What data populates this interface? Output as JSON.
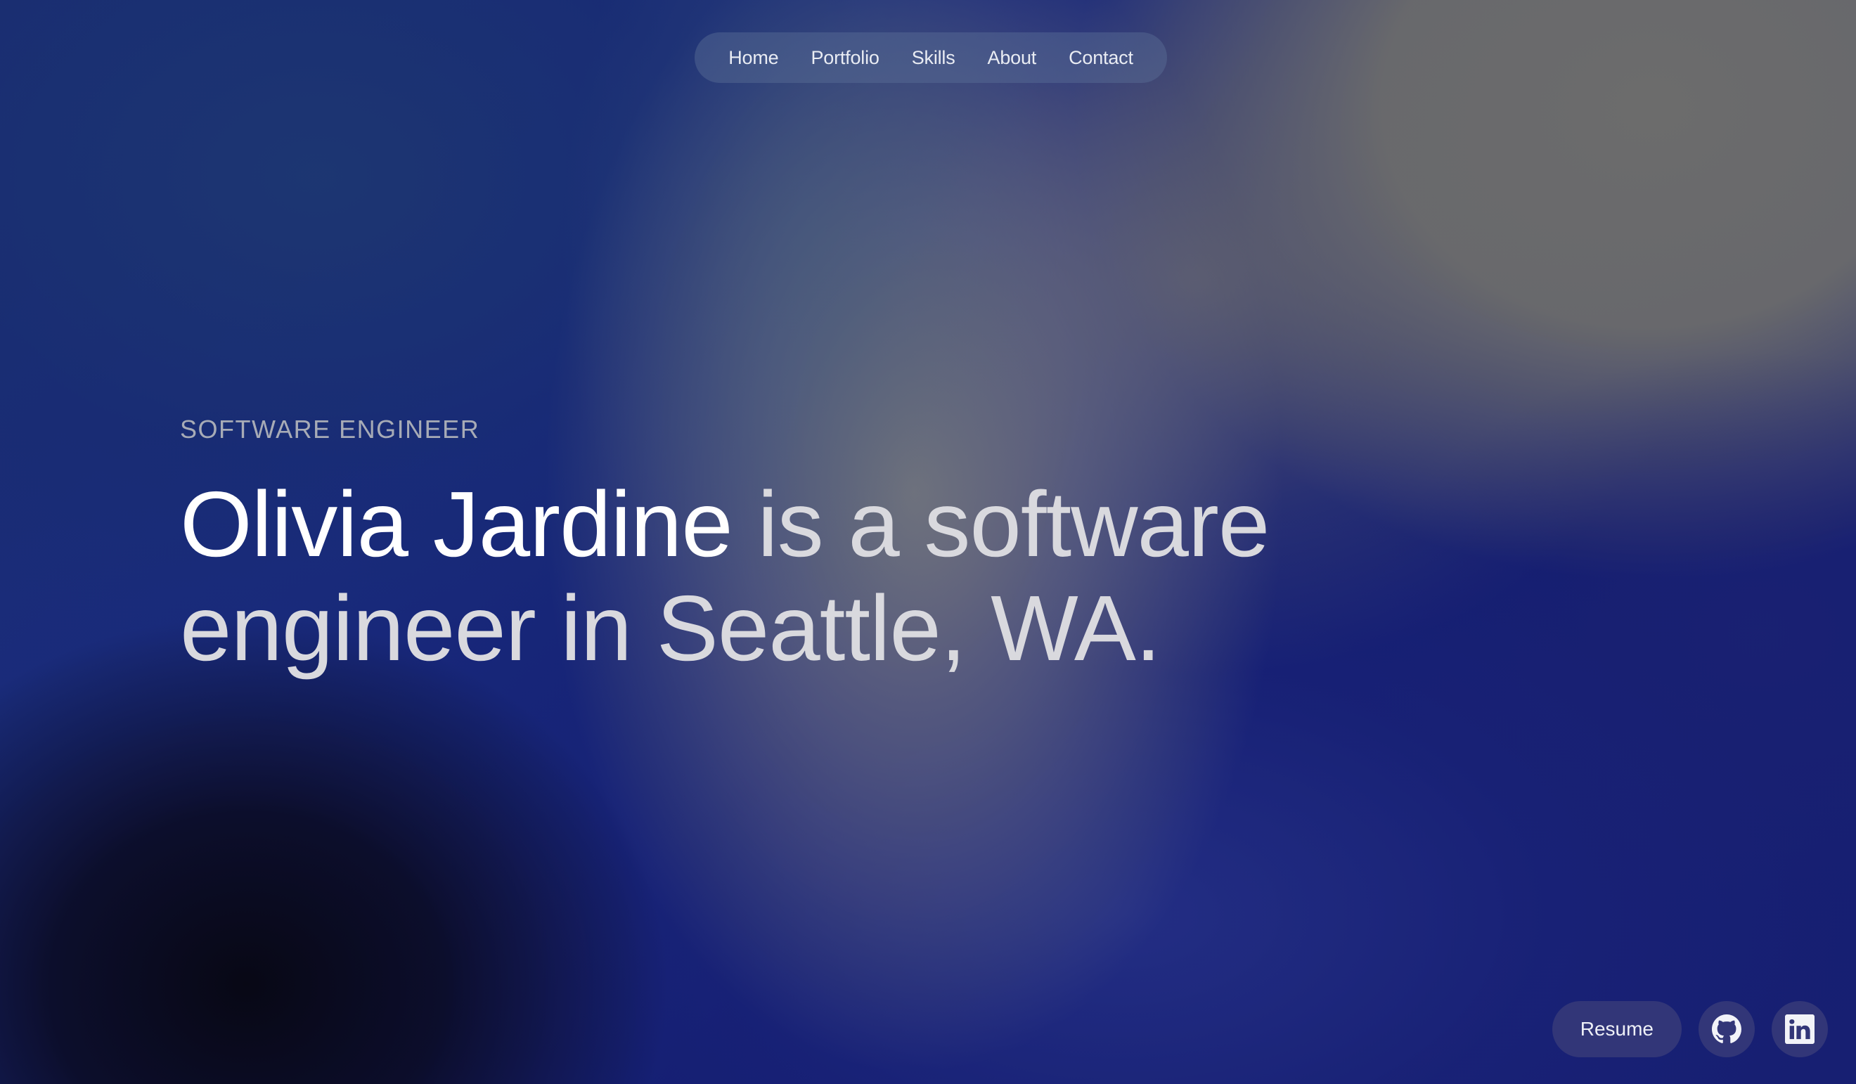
{
  "nav": {
    "items": [
      {
        "label": "Home"
      },
      {
        "label": "Portfolio"
      },
      {
        "label": "Skills"
      },
      {
        "label": "About"
      },
      {
        "label": "Contact"
      }
    ]
  },
  "hero": {
    "eyebrow": "SOFTWARE ENGINEER",
    "name": "Olivia Jardine",
    "tagline": " is a software engineer in Seattle, WA."
  },
  "actions": {
    "resume_label": "Resume",
    "github_icon": "github-icon",
    "linkedin_icon": "linkedin-icon"
  },
  "colors": {
    "accent_button": "#343878",
    "background_deep": "#101a5e",
    "background_gray": "#6c6c6c"
  }
}
